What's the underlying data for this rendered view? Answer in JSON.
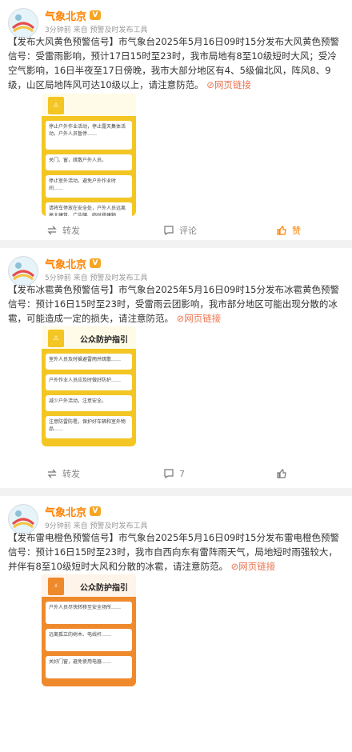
{
  "feed": {
    "account_name": "气象北京",
    "verified_badge": "V",
    "posts": [
      {
        "time": "3分钟前",
        "source": "来自 预警及时发布工具",
        "text": "【发布大风黄色预警信号】市气象台2025年5月16日09时15分发布大风黄色预警信号：受雷雨影响，预计17日15时至23时，我市局地有8至10级短时大风；受冷空气影响，16日半夜至17日傍晚，我市大部分地区有4、5级偏北风，阵风8、9级，山区局地阵风可达10级以上，请注意防范。",
        "link_text": "网页链接",
        "poster": {
          "theme": "yellow",
          "title": "",
          "tips": [
            "停止户外作业活动，停止露天集体活动，户外人员暂停……",
            "关门、窗，疏散户外人员。",
            "停止室外活动，避免户外作业时间……",
            "请将车停放在安全处，户外人员远离高大建筑、广告牌、临时搭建物……"
          ]
        },
        "repost_label": "转发",
        "comment_label": "评论",
        "like_label": "赞"
      },
      {
        "time": "5分钟前",
        "source": "来自 预警及时发布工具",
        "text": "【发布冰雹黄色预警信号】市气象台2025年5月16日09时15分发布冰雹黄色预警信号：预计16日15时至23时，受雷雨云团影响，我市部分地区可能出现分散的冰雹，可能造成一定的损失，请注意防范。",
        "link_text": "网页链接",
        "poster": {
          "theme": "yellow",
          "title": "公众防护指引",
          "tips": [
            "室外人员及时躲避雷雨并疏散……",
            "户外作业人员应及时做好防护……",
            "减少户外活动，注意安全。",
            "注意防雷防雹，保护好车辆和室外物品……"
          ]
        },
        "repost_label": "转发",
        "comment_count": "7",
        "like_label": ""
      },
      {
        "time": "9分钟前",
        "source": "来自 预警及时发布工具",
        "text": "【发布雷电橙色预警信号】市气象台2025年5月16日09时15分发布雷电橙色预警信号：预计16日15时至23时，我市自西向东有雷阵雨天气，局地短时雨强较大，并伴有8至10级短时大风和分散的冰雹，请注意防范。",
        "link_text": "网页链接",
        "poster": {
          "theme": "orange",
          "title": "公众防护指引",
          "tips": [
            "户外人员尽快转移至安全场所……",
            "远离孤立的树木、电线杆……",
            "关好门窗，避免使用电器……"
          ]
        }
      }
    ]
  },
  "colors": {
    "brand_orange": "#ff8200",
    "link": "#eb7350",
    "poster_yellow": "#f3c623",
    "poster_orange": "#ef8a2c",
    "background": "#f2f2f2"
  }
}
